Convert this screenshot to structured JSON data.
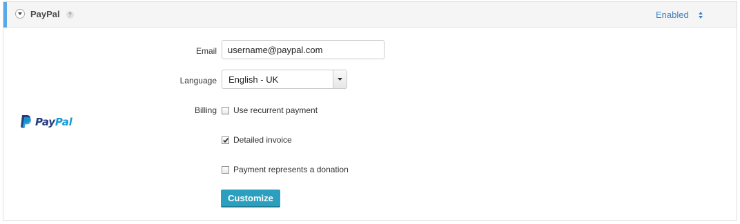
{
  "header": {
    "title": "PayPal",
    "help_glyph": "?",
    "status": "Enabled",
    "accent_color": "#5aa9e6",
    "status_color": "#3a7fc6"
  },
  "logo": {
    "text_pay": "Pay",
    "text_pal": "Pal",
    "colors": {
      "dark": "#253b80",
      "light": "#179bd7"
    }
  },
  "form": {
    "email_label": "Email",
    "email_value": "username@paypal.com",
    "language_label": "Language",
    "language_value": "English - UK",
    "billing_label": "Billing",
    "options": [
      {
        "label": "Use recurrent payment",
        "checked": false
      },
      {
        "label": "Detailed invoice",
        "checked": true
      },
      {
        "label": "Payment represents a donation",
        "checked": false
      }
    ],
    "customize_label": "Customize",
    "button_color": "#2b9fbd"
  }
}
